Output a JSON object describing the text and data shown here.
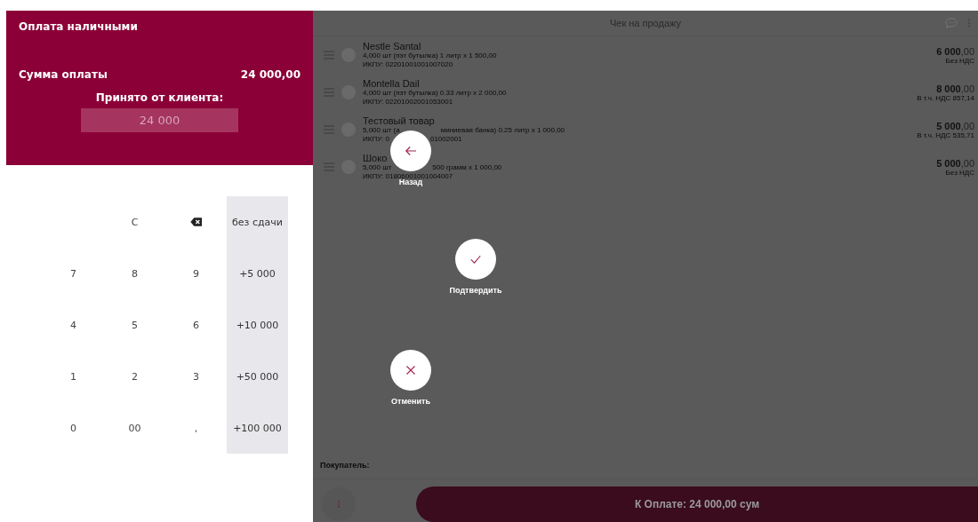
{
  "payment_panel": {
    "title": "Оплата наличными",
    "sum_label": "Сумма оплаты",
    "sum_value": "24 000,00",
    "received_label": "Принято от клиента:",
    "received_value": "24 000"
  },
  "keypad": [
    [
      {
        "kind": "empty"
      },
      {
        "kind": "key",
        "label": "C"
      },
      {
        "kind": "backspace"
      },
      {
        "kind": "quick",
        "label": "без сдачи"
      }
    ],
    [
      {
        "kind": "key",
        "label": "7"
      },
      {
        "kind": "key",
        "label": "8"
      },
      {
        "kind": "key",
        "label": "9"
      },
      {
        "kind": "quick",
        "label": "+5 000"
      }
    ],
    [
      {
        "kind": "key",
        "label": "4"
      },
      {
        "kind": "key",
        "label": "5"
      },
      {
        "kind": "key",
        "label": "6"
      },
      {
        "kind": "quick",
        "label": "+10 000"
      }
    ],
    [
      {
        "kind": "key",
        "label": "1"
      },
      {
        "kind": "key",
        "label": "2"
      },
      {
        "kind": "key",
        "label": "3"
      },
      {
        "kind": "quick",
        "label": "+50 000"
      }
    ],
    [
      {
        "kind": "key",
        "label": "0"
      },
      {
        "kind": "key",
        "label": "00"
      },
      {
        "kind": "key",
        "label": ","
      },
      {
        "kind": "quick",
        "label": "+100 000"
      }
    ]
  ],
  "receipt": {
    "title": "Чек на продажу",
    "items": [
      {
        "name": [
          "Nestle Santal"
        ],
        "detail": [
          "4,000 шт (пэт бутылка) 1 литр x 1 500,00"
        ],
        "code": [
          "ИКПУ: 02201001001007020"
        ],
        "total": "**6 000**,00",
        "tax": "Без НДС"
      },
      {
        "name": [
          "Montella Dail"
        ],
        "detail": [
          "4,000 шт (пэт бутылка) 0.33 литр x 2 000,00"
        ],
        "code": [
          "ИКПУ: 02201002001053001"
        ],
        "total": "**8 000**,00",
        "tax": "В т.ч. НДС 857,14"
      },
      {
        "name": [
          "Тестовый товар"
        ],
        "detail": [
          "5,000 шт (а",
          "миниевая банка) 0.25 литр x 1 000,00"
        ],
        "code": [
          "ИКПУ: 0",
          "01002001"
        ],
        "total": "**5 000**,00",
        "tax": "В т.ч. НДС 535,71"
      },
      {
        "name": [
          "Шоко"
        ],
        "detail": [
          "5,000 шт",
          "500 грамм x 1 000,00"
        ],
        "code": [
          "ИКПУ: 01806001001004007"
        ],
        "total": "**5 000**,00",
        "tax": "Без НДС"
      }
    ],
    "buyer_label": "Покупатель:",
    "pay_button": "К Оплате: 24 000,00 сум"
  },
  "actions": [
    {
      "kind": "back",
      "label": "Назад"
    },
    {
      "kind": "confirm",
      "label": "Подтвердить"
    },
    {
      "kind": "cancel",
      "label": "Отменить"
    }
  ]
}
